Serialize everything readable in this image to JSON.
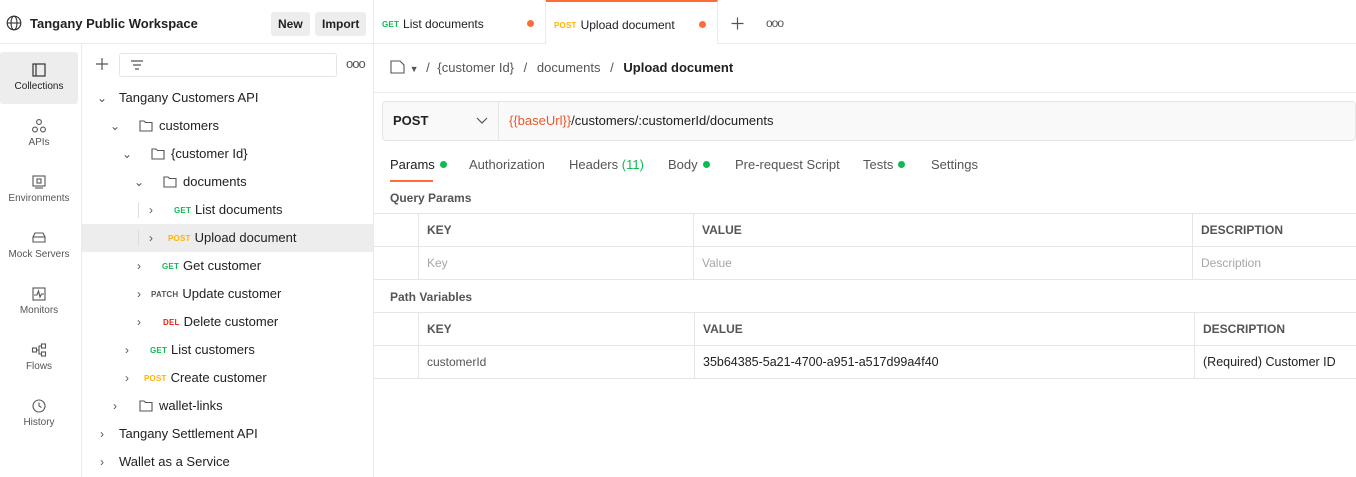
{
  "workspace": {
    "title": "Tangany Public Workspace",
    "new_label": "New",
    "import_label": "Import"
  },
  "rail": {
    "items": [
      {
        "label": "Collections",
        "icon": "collections-icon"
      },
      {
        "label": "APIs",
        "icon": "apis-icon"
      },
      {
        "label": "Environments",
        "icon": "environments-icon"
      },
      {
        "label": "Mock Servers",
        "icon": "mock-servers-icon"
      },
      {
        "label": "Monitors",
        "icon": "monitors-icon"
      },
      {
        "label": "Flows",
        "icon": "flows-icon"
      },
      {
        "label": "History",
        "icon": "history-icon"
      }
    ]
  },
  "tree": {
    "items": [
      {
        "label": "Tangany Customers API"
      },
      {
        "label": "customers"
      },
      {
        "label": "{customer Id}"
      },
      {
        "label": "documents"
      },
      {
        "method": "GET",
        "label": "List documents"
      },
      {
        "method": "POST",
        "label": "Upload document"
      },
      {
        "method": "GET",
        "label": "Get customer"
      },
      {
        "method": "PATCH",
        "label": "Update customer"
      },
      {
        "method": "DEL",
        "label": "Delete customer"
      },
      {
        "method": "GET",
        "label": "List customers"
      },
      {
        "method": "POST",
        "label": "Create customer"
      },
      {
        "label": "wallet-links"
      },
      {
        "label": "Tangany Settlement API"
      },
      {
        "label": "Wallet as a Service"
      }
    ]
  },
  "tabs": [
    {
      "method": "GET",
      "label": "List documents"
    },
    {
      "method": "POST",
      "label": "Upload document"
    }
  ],
  "breadcrumb": {
    "part1": "{customer Id}",
    "part2": "documents",
    "current": "Upload document",
    "sep": "/"
  },
  "request": {
    "method": "POST",
    "url_var": "{{baseUrl}}",
    "url_rest": "/customers/:customerId/documents"
  },
  "request_tabs": {
    "params": "Params",
    "authorization": "Authorization",
    "headers": "Headers",
    "headers_count": "(11)",
    "body": "Body",
    "prerequest": "Pre-request Script",
    "tests": "Tests",
    "settings": "Settings"
  },
  "query_params": {
    "title": "Query Params",
    "headers": [
      "KEY",
      "VALUE",
      "DESCRIPTION"
    ],
    "placeholders": [
      "Key",
      "Value",
      "Description"
    ]
  },
  "path_variables": {
    "title": "Path Variables",
    "headers": [
      "KEY",
      "VALUE",
      "DESCRIPTION"
    ],
    "rows": [
      {
        "key": "customerId",
        "value": "35b64385-5a21-4700-a951-a517d99a4f40",
        "description": "(Required) Customer ID"
      }
    ]
  },
  "colors": {
    "accent": "#ff6c37",
    "get": "#0cbb52",
    "post": "#ffb400",
    "delete": "#eb2013",
    "url_var": "#e8582c"
  }
}
